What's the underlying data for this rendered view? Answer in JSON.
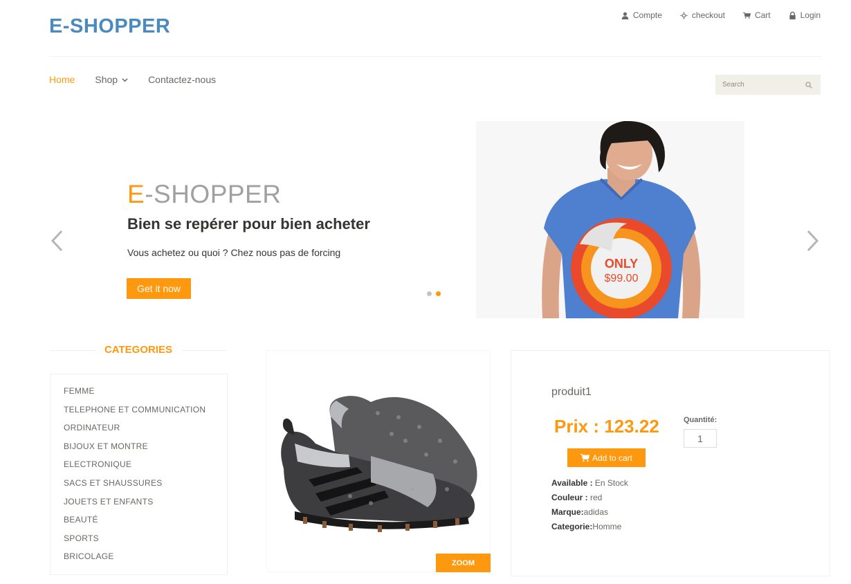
{
  "header": {
    "logo": "E-SHOPPER",
    "top_links": [
      {
        "label": "Compte",
        "icon": "user-icon"
      },
      {
        "label": "checkout",
        "icon": "crosshairs-icon"
      },
      {
        "label": "Cart",
        "icon": "cart-icon"
      },
      {
        "label": "Login",
        "icon": "lock-icon"
      }
    ]
  },
  "nav": {
    "home": "Home",
    "shop": "Shop",
    "contact": "Contactez-nous"
  },
  "search": {
    "placeholder": "Search"
  },
  "slider": {
    "brand_first": "E",
    "brand_rest": "-SHOPPER",
    "title": "Bien se repérer pour bien acheter",
    "text": "Vous achetez ou quoi ? Chez nous pas de forcing",
    "button": "Get it now",
    "badge_top": "ONLY",
    "badge_price": "$99.00",
    "active_slide": 2,
    "slide_count": 2
  },
  "categories": {
    "title": "CATEGORIES",
    "items": [
      "FEMME",
      "TELEPHONE ET COMMUNICATION",
      "ORDINATEUR",
      "BIJOUX ET MONTRE",
      "ELECTRONIQUE",
      "SACS ET SHAUSSURES",
      "JOUETS ET ENFANTS",
      "BEAUTÉ",
      "SPORTS",
      "BRICOLAGE"
    ]
  },
  "product": {
    "name": "produit1",
    "price": "Prix : 123.22",
    "quantity_label": "Quantité:",
    "quantity": "1",
    "add_to_cart": "Add to cart",
    "zoom": "ZOOM",
    "available_label": "Available :",
    "available": " En Stock",
    "color_label": "Couleur :",
    "color": " red",
    "brand_label": "Marque:",
    "brand": "adidas",
    "category_label": "Categorie:",
    "category": "Homme"
  },
  "colors": {
    "accent": "#fe980f",
    "logo": "#4a8ac3",
    "text": "#696763"
  }
}
